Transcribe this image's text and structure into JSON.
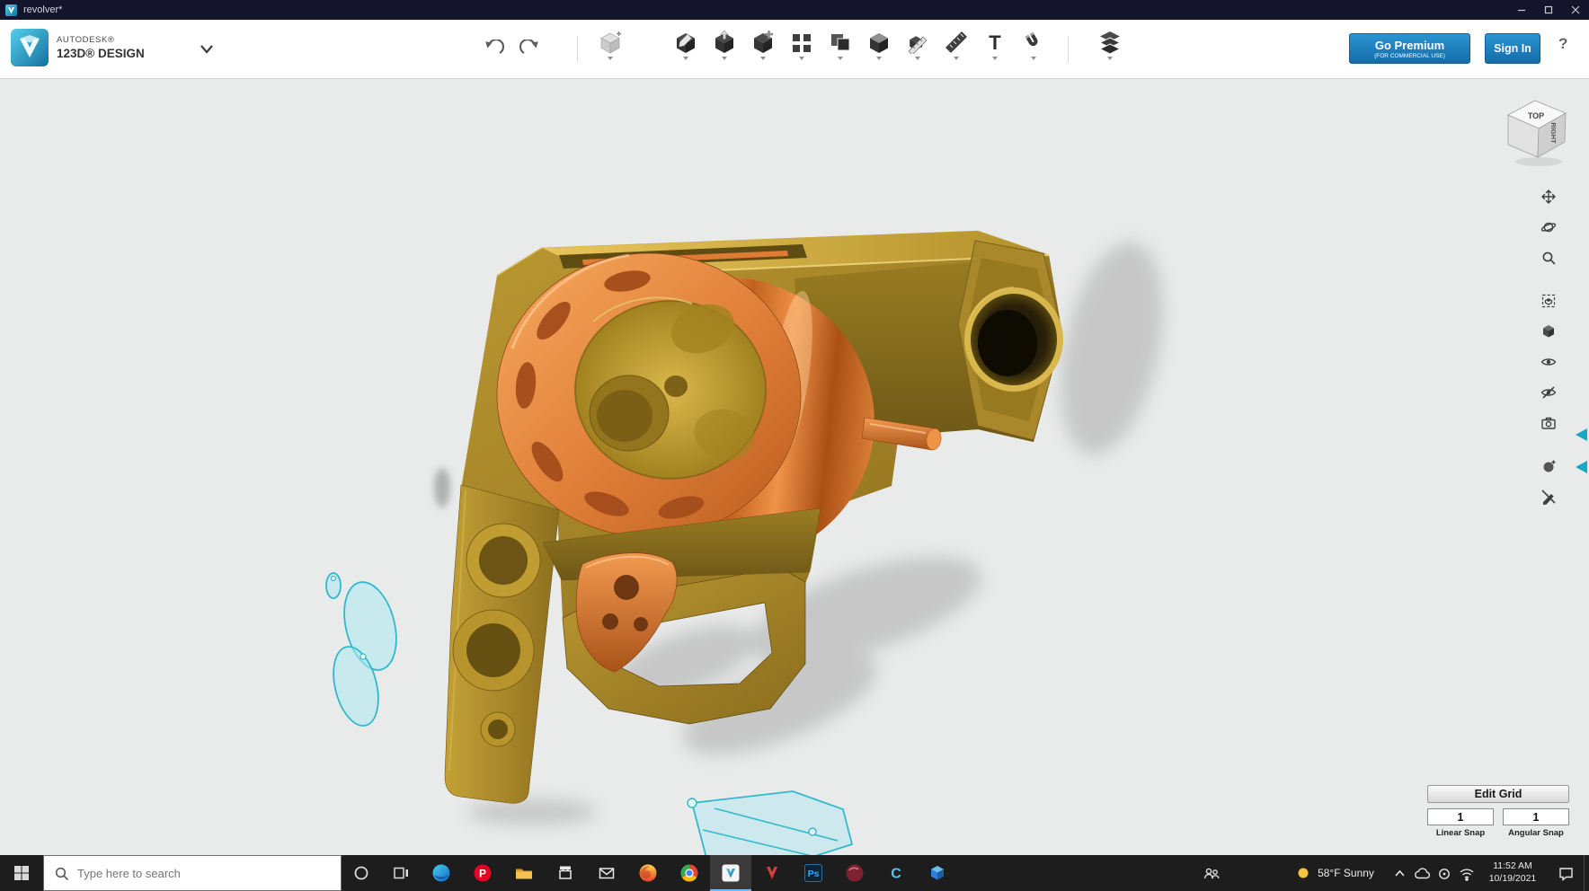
{
  "window": {
    "title": "revolver*"
  },
  "brand": {
    "autodesk": "AUTODESK®",
    "product": "123D® DESIGN"
  },
  "toolbar": {
    "go_premium": {
      "label": "Go Premium",
      "sublabel": "(FOR COMMERCIAL USE)"
    },
    "sign_in": "Sign In",
    "help": "?",
    "text_tool": "T",
    "tool_names": [
      "undo",
      "redo",
      "primitives",
      "sketch",
      "construct",
      "modify",
      "pattern",
      "grouping",
      "combine",
      "measure",
      "ruler",
      "text",
      "snap",
      "material"
    ]
  },
  "viewport": {
    "viewcube": {
      "top": "TOP",
      "right": "RIGHT"
    },
    "edit_grid": {
      "button": "Edit Grid",
      "linear": {
        "value": "1",
        "label": "Linear Snap"
      },
      "angular": {
        "value": "1",
        "label": "Angular Snap"
      }
    },
    "model": {
      "name": "revolver",
      "body_color": "#b8952d",
      "cylinder_color": "#e0813a",
      "sketch_color": "#2fb9cc"
    }
  },
  "right_toolbar": {
    "icons": [
      "pan",
      "orbit",
      "zoom",
      "fit-view",
      "view-cube",
      "visibility",
      "hide",
      "snapshot",
      "material",
      "outline"
    ]
  },
  "taskbar": {
    "search": {
      "placeholder": "Type here to search"
    },
    "glyphs": {
      "pinterest": "P",
      "photoshop": "Ps",
      "c_app": "C"
    },
    "apps": [
      "edge",
      "pinterest",
      "file-explorer",
      "store",
      "mail",
      "firefox",
      "chrome",
      "123d-design",
      "red-v-app",
      "photoshop",
      "maroon-app",
      "c-app",
      "3d-viewer"
    ],
    "active_app": "123d-design",
    "tray": {
      "weather": "58°F  Sunny",
      "time": "11:52 AM",
      "date": "10/19/2021"
    }
  }
}
